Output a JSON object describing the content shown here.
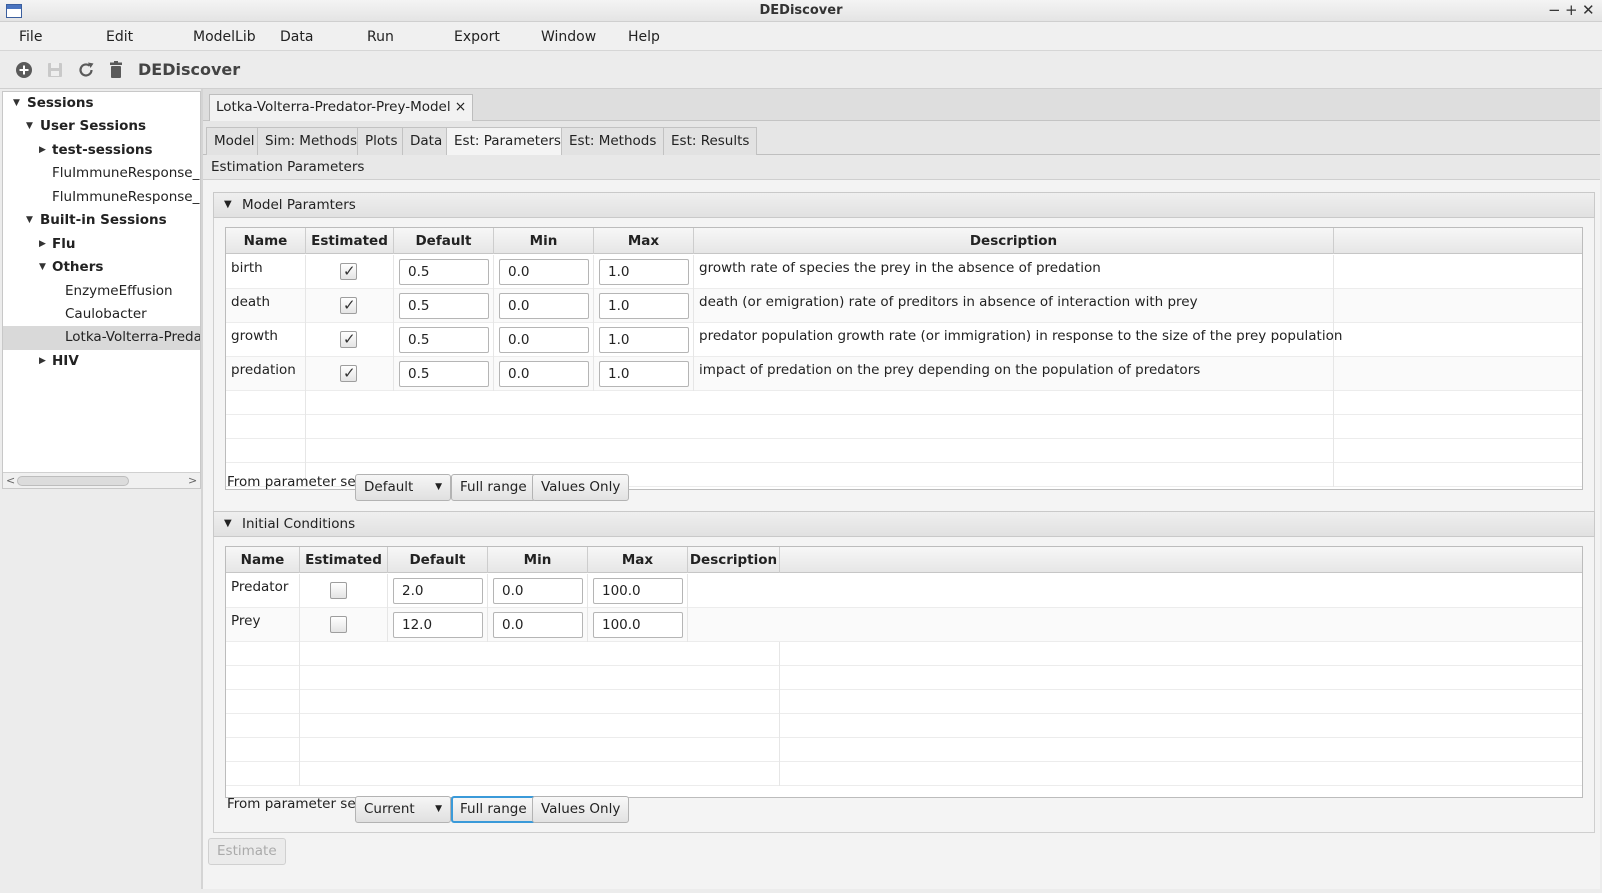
{
  "window": {
    "title": "DEDiscover",
    "controls": [
      "−",
      "+",
      "✕"
    ]
  },
  "menu": [
    "File",
    "Edit",
    "ModelLib",
    "Data",
    "Run",
    "Export",
    "Window",
    "Help"
  ],
  "toolbar": {
    "app_name": "DEDiscover",
    "icons": [
      "add-icon",
      "save-icon",
      "refresh-icon",
      "trash-icon"
    ]
  },
  "tree": {
    "items": [
      {
        "label": "Sessions",
        "expanded": true
      },
      {
        "label": "User Sessions",
        "expanded": true
      },
      {
        "label": "test-sessions",
        "expanded": false
      },
      {
        "label": "FluImmuneResponse_C"
      },
      {
        "label": "FluImmuneResponse_E"
      },
      {
        "label": "Built-in Sessions",
        "expanded": true
      },
      {
        "label": "Flu",
        "expanded": false
      },
      {
        "label": "Others",
        "expanded": true
      },
      {
        "label": "EnzymeEffusion"
      },
      {
        "label": "Caulobacter"
      },
      {
        "label": "Lotka-Volterra-Preda",
        "selected": true
      },
      {
        "label": "HIV",
        "expanded": false
      }
    ]
  },
  "doc_tab": {
    "label": "Lotka-Volterra-Predator-Prey-Model",
    "close": "×"
  },
  "tabs": [
    "Model",
    "Sim: Methods",
    "Plots",
    "Data",
    "Est: Parameters",
    "Est: Methods",
    "Est: Results"
  ],
  "active_tab": "Est: Parameters",
  "section_title": "Estimation Parameters",
  "model_params": {
    "title": "Model Paramters",
    "columns": [
      "Name",
      "Estimated",
      "Default",
      "Min",
      "Max",
      "Description"
    ],
    "rows": [
      {
        "name": "birth",
        "estimated": true,
        "default": "0.5",
        "min": "0.0",
        "max": "1.0",
        "description": "growth rate of species the prey in the absence of predation"
      },
      {
        "name": "death",
        "estimated": true,
        "default": "0.5",
        "min": "0.0",
        "max": "1.0",
        "description": "death (or emigration) rate of preditors in absence of interaction with prey"
      },
      {
        "name": "growth",
        "estimated": true,
        "default": "0.5",
        "min": "0.0",
        "max": "1.0",
        "description": "predator population growth rate (or immigration) in response to the size of the prey population"
      },
      {
        "name": "predation",
        "estimated": true,
        "default": "0.5",
        "min": "0.0",
        "max": "1.0",
        "description": "impact of predation on the prey depending on the population of predators"
      }
    ],
    "from_label": "From parameter set",
    "param_set": "Default",
    "full_range": "Full range",
    "values_only": "Values Only"
  },
  "initial_conditions": {
    "title": "Initial Conditions",
    "columns": [
      "Name",
      "Estimated",
      "Default",
      "Min",
      "Max",
      "Description"
    ],
    "rows": [
      {
        "name": "Predator",
        "estimated": false,
        "default": "2.0",
        "min": "0.0",
        "max": "100.0",
        "description": ""
      },
      {
        "name": "Prey",
        "estimated": false,
        "default": "12.0",
        "min": "0.0",
        "max": "100.0",
        "description": ""
      }
    ],
    "from_label": "From parameter set",
    "param_set": "Current",
    "full_range": "Full range",
    "values_only": "Values Only"
  },
  "estimate_button": "Estimate"
}
